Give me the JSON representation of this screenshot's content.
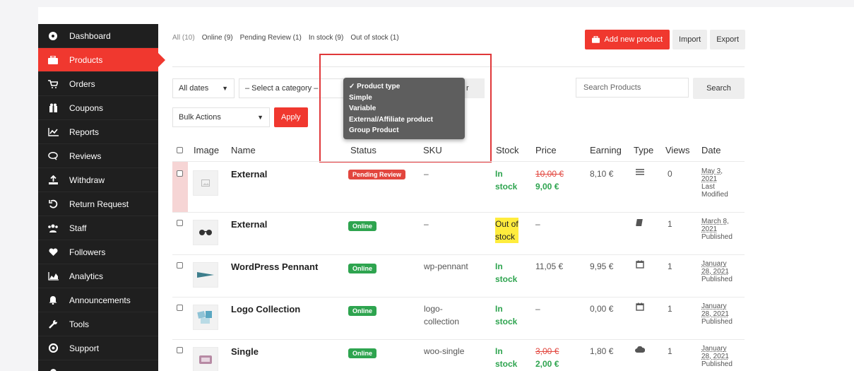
{
  "sidebar": {
    "items": [
      {
        "label": "Dashboard",
        "icon": "dashboard-icon"
      },
      {
        "label": "Products",
        "icon": "briefcase-icon"
      },
      {
        "label": "Orders",
        "icon": "cart-icon"
      },
      {
        "label": "Coupons",
        "icon": "gift-icon"
      },
      {
        "label": "Reports",
        "icon": "chart-icon"
      },
      {
        "label": "Reviews",
        "icon": "comment-icon"
      },
      {
        "label": "Withdraw",
        "icon": "upload-icon"
      },
      {
        "label": "Return Request",
        "icon": "undo-icon"
      },
      {
        "label": "Staff",
        "icon": "users-icon"
      },
      {
        "label": "Followers",
        "icon": "heart-icon"
      },
      {
        "label": "Analytics",
        "icon": "area-chart-icon"
      },
      {
        "label": "Announcements",
        "icon": "bell-icon"
      },
      {
        "label": "Tools",
        "icon": "wrench-icon"
      },
      {
        "label": "Support",
        "icon": "lifebuoy-icon"
      }
    ],
    "active_color": "#f0382f"
  },
  "filters": {
    "all": "All (10)",
    "online": "Online (9)",
    "pending": "Pending Review (1)",
    "instock": "In stock (9)",
    "outofstock": "Out of stock (1)"
  },
  "toolbar": {
    "add_new": "Add new product",
    "import": "Import",
    "export": "Export"
  },
  "controls": {
    "dates": "All dates",
    "category": "– Select a category –",
    "filter": "r",
    "bulk": "Bulk Actions",
    "apply": "Apply",
    "search_placeholder": "Search Products",
    "search_button": "Search"
  },
  "product_type_dropdown": {
    "options": [
      "✓ Product type",
      "Simple",
      "Variable",
      "External/Affiliate product",
      "Group Product"
    ]
  },
  "table": {
    "headers": {
      "image": "Image",
      "name": "Name",
      "status": "Status",
      "sku": "SKU",
      "stock": "Stock",
      "price": "Price",
      "earning": "Earning",
      "type": "Type",
      "views": "Views",
      "date": "Date"
    },
    "rows": [
      {
        "name": "External",
        "status": "Pending Review",
        "sku": "–",
        "stock1": "In",
        "stock2": "stock",
        "price_old": "10,00 €",
        "price_new": "9,00 €",
        "price": "",
        "earning": "8,10 €",
        "views": "0",
        "date1": "May 3,",
        "date2": "2021",
        "date3": "Last",
        "date4": "Modified"
      },
      {
        "name": "External",
        "status": "Online",
        "sku": "–",
        "stock1": "Out of",
        "stock2": "stock",
        "price": "–",
        "earning": "",
        "views": "1",
        "date1": "March 8,",
        "date2": "2021",
        "date3": "Published"
      },
      {
        "name": "WordPress Pennant",
        "status": "Online",
        "sku": "wp-pennant",
        "stock1": "In",
        "stock2": "stock",
        "price": "11,05 €",
        "earning": "9,95 €",
        "views": "1",
        "date1": "January",
        "date2": "28, 2021",
        "date3": "Published"
      },
      {
        "name": "Logo Collection",
        "status": "Online",
        "sku1": "logo-",
        "sku2": "collection",
        "stock1": "In",
        "stock2": "stock",
        "price": "–",
        "earning": "0,00 €",
        "views": "1",
        "date1": "January",
        "date2": "28, 2021",
        "date3": "Published"
      },
      {
        "name": "Single",
        "status": "Online",
        "sku": "woo-single",
        "stock1": "In",
        "stock2": "stock",
        "price_old": "3,00 €",
        "price_new": "2,00 €",
        "earning": "1,80 €",
        "views": "1",
        "date1": "January",
        "date2": "28, 2021",
        "date3": "Published"
      }
    ]
  }
}
